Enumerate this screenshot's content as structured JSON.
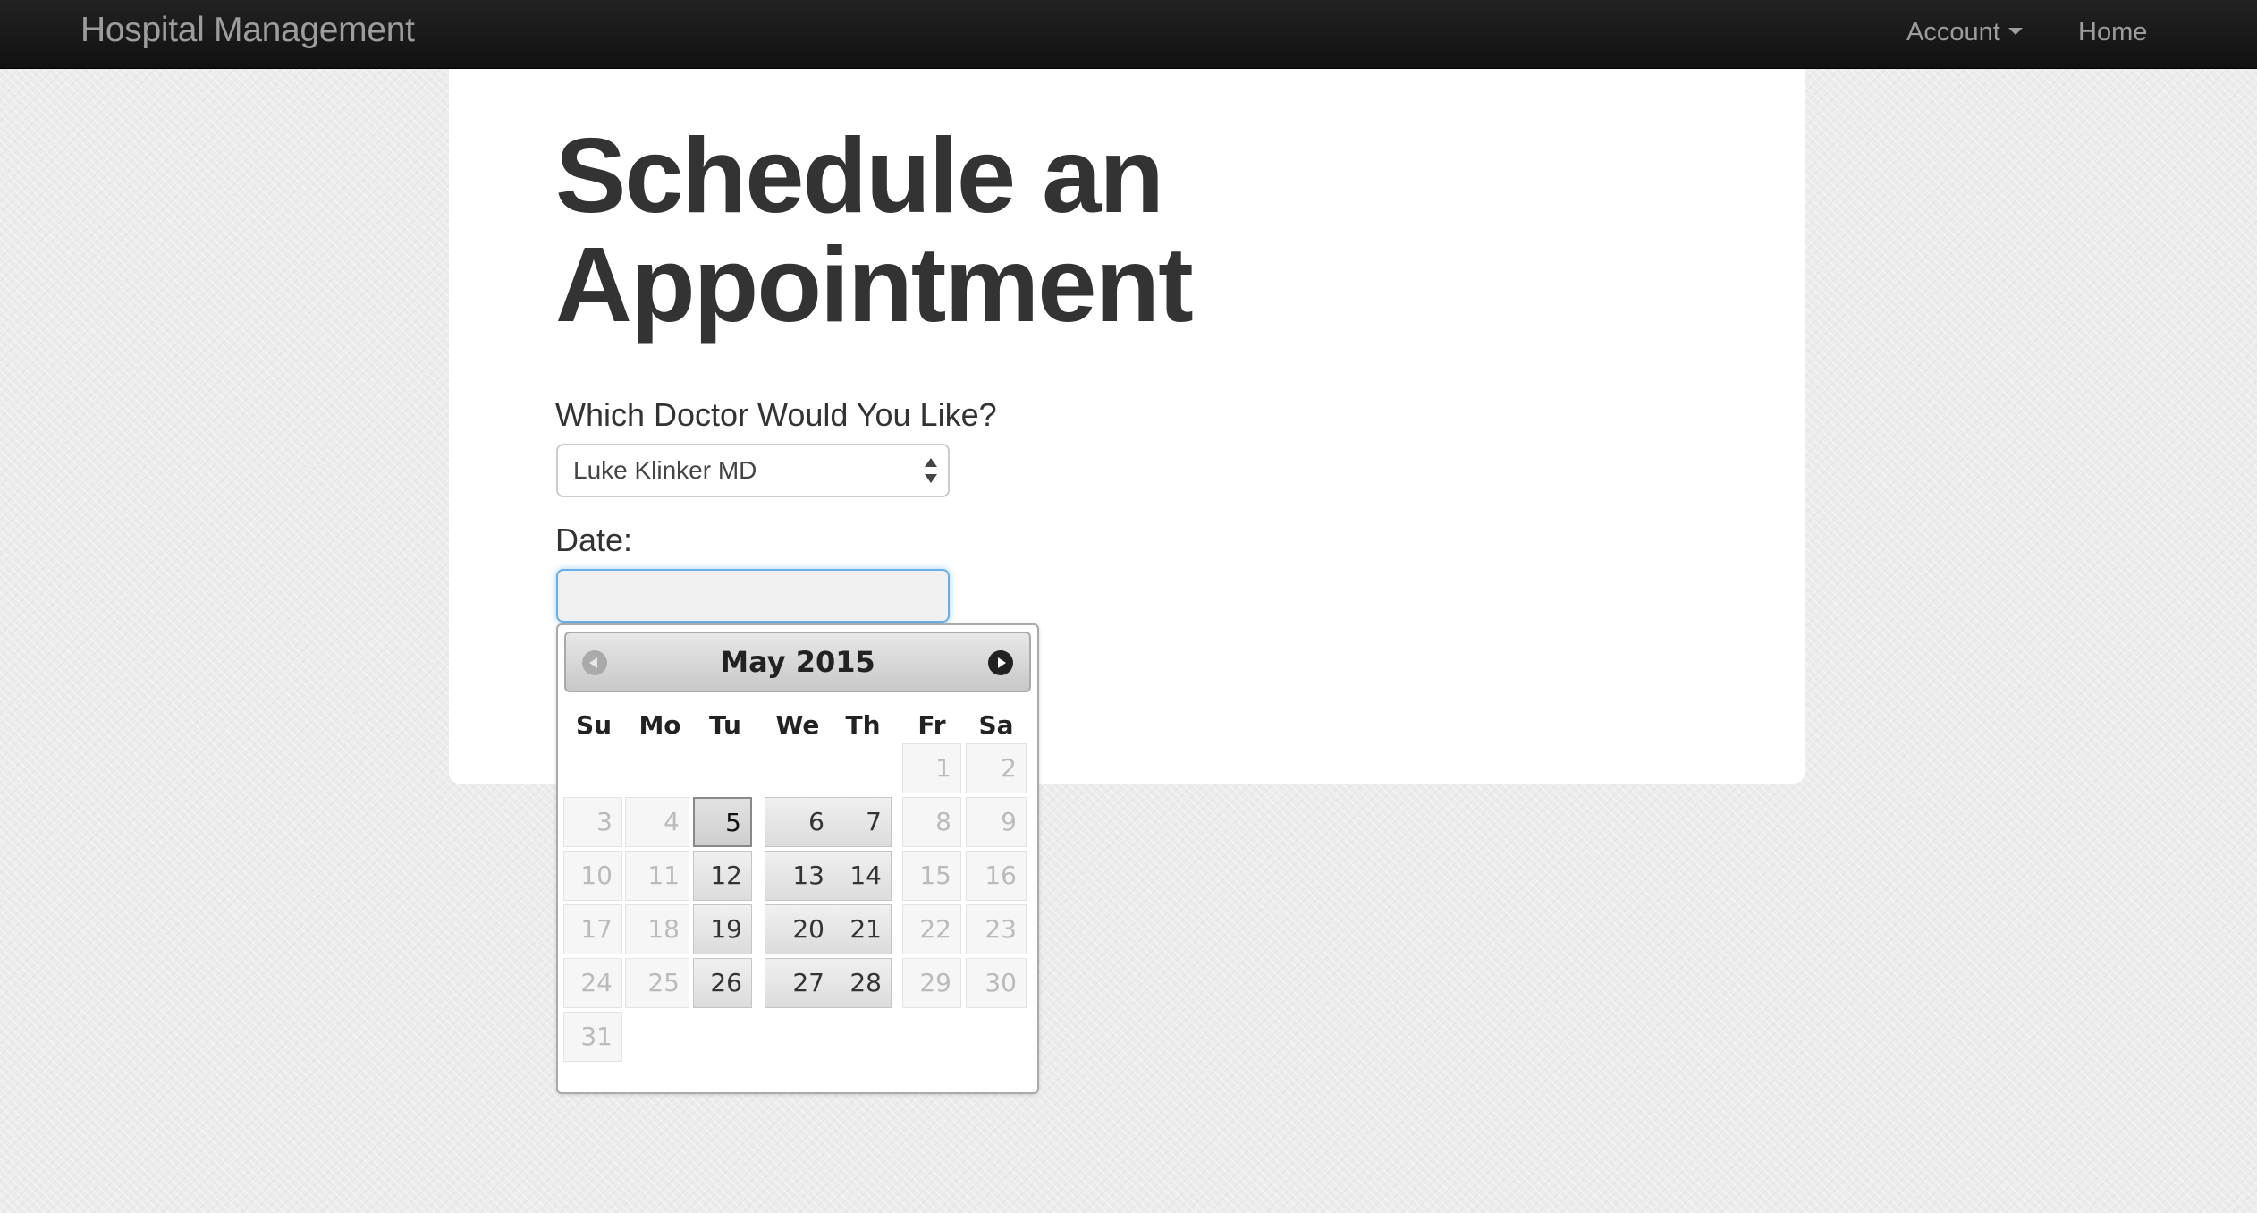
{
  "navbar": {
    "brand": "Hospital Management",
    "account_label": "Account",
    "home_label": "Home"
  },
  "page": {
    "title_line1": "Schedule an",
    "title_line2": "Appointment"
  },
  "form": {
    "doctor_label": "Which Doctor Would You Like?",
    "doctor_selected": "Luke Klinker MD",
    "date_label": "Date:",
    "date_value": ""
  },
  "datepicker": {
    "month_year": "May 2015",
    "weekdays": [
      "Su",
      "Mo",
      "Tu",
      "We",
      "Th",
      "Fr",
      "Sa"
    ],
    "days": [
      {
        "day": "1",
        "enabled": false
      },
      {
        "day": "2",
        "enabled": false
      },
      {
        "day": "3",
        "enabled": false
      },
      {
        "day": "4",
        "enabled": false
      },
      {
        "day": "5",
        "enabled": true,
        "selected": true
      },
      {
        "day": "6",
        "enabled": true
      },
      {
        "day": "7",
        "enabled": true
      },
      {
        "day": "8",
        "enabled": false
      },
      {
        "day": "9",
        "enabled": false
      },
      {
        "day": "10",
        "enabled": false
      },
      {
        "day": "11",
        "enabled": false
      },
      {
        "day": "12",
        "enabled": true
      },
      {
        "day": "13",
        "enabled": true
      },
      {
        "day": "14",
        "enabled": true
      },
      {
        "day": "15",
        "enabled": false
      },
      {
        "day": "16",
        "enabled": false
      },
      {
        "day": "17",
        "enabled": false
      },
      {
        "day": "18",
        "enabled": false
      },
      {
        "day": "19",
        "enabled": true
      },
      {
        "day": "20",
        "enabled": true
      },
      {
        "day": "21",
        "enabled": true
      },
      {
        "day": "22",
        "enabled": false
      },
      {
        "day": "23",
        "enabled": false
      },
      {
        "day": "24",
        "enabled": false
      },
      {
        "day": "25",
        "enabled": false
      },
      {
        "day": "26",
        "enabled": true
      },
      {
        "day": "27",
        "enabled": true
      },
      {
        "day": "28",
        "enabled": true
      },
      {
        "day": "29",
        "enabled": false
      },
      {
        "day": "30",
        "enabled": false
      },
      {
        "day": "31",
        "enabled": false
      }
    ],
    "first_weekday_index": 5,
    "prev_icon": "arrow-left-circle-icon",
    "next_icon": "arrow-right-circle-icon"
  }
}
